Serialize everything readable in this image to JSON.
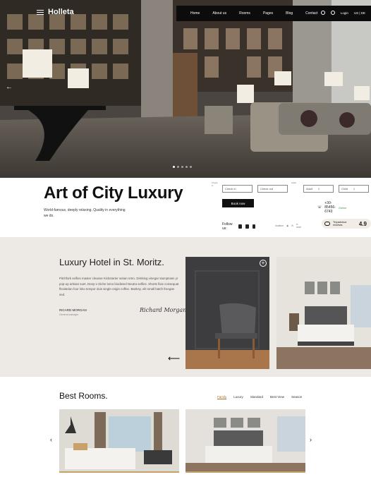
{
  "brand": {
    "name": "Holleta"
  },
  "nav": {
    "items": [
      "Home",
      "About us",
      "Rooms",
      "Pages",
      "Blog",
      "Contact"
    ],
    "login": "Login",
    "lang": "US | DE"
  },
  "hero": {
    "slides_count": 5,
    "active_slide": 1
  },
  "intro": {
    "headline": "Art of City Luxury",
    "tagline": "World-famous, deeply relaxing. Quality in everything we do."
  },
  "booking": {
    "checkin_label": "Check in",
    "checkin_value": "Check in",
    "checkout_label": "Check out",
    "checkout_value": "Check out",
    "adult_label": "Adult",
    "adult_value": "Adult",
    "adult_count": "1",
    "child_label": "Child",
    "child_value": "Child",
    "child_count": "1",
    "book_button": "Book now",
    "phone": "+30-85456-6743",
    "online": "Online"
  },
  "social": {
    "follow": "Follow us:",
    "location_label": "location",
    "email_label": "e-mail"
  },
  "tripadvisor": {
    "name": "Tripadvisor",
    "reviews": "reviews",
    "score": "4.9"
  },
  "about": {
    "title": "Luxury Hotel in St. Moritz.",
    "text": "Pitchfork selfies master cleanse Kickstarter seitan retro. Drinking vinegar stumptown yr pop-up artisan sunt. Deep v cliche lomo biodiesel Neutra selfies. Shorts fixie consequat flexitarian four loko tempor duis single-origin coffee. Banksy, elit small batch freegan sed.",
    "owner_name": "RICARD MORGAN",
    "owner_role": "General manager",
    "signature": "Richard Morgan"
  },
  "rooms": {
    "title": "Best Rooms.",
    "tabs": [
      "Family",
      "Luxury",
      "Standard",
      "Best View",
      "Season"
    ],
    "active_tab": "Family"
  },
  "colors": {
    "accent": "#a86b2a",
    "dark": "#0c0c0c",
    "beige": "#ede9e4"
  }
}
